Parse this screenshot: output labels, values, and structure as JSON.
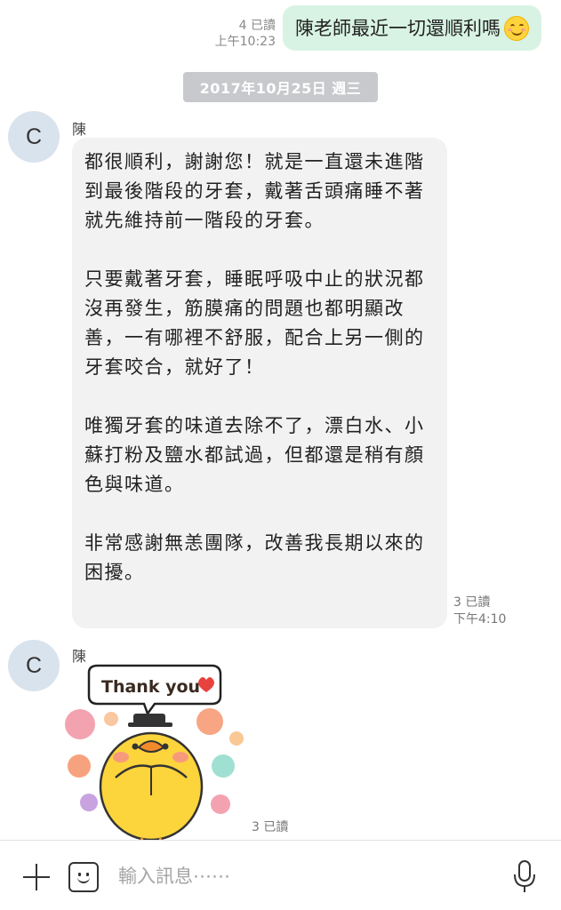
{
  "outgoing": {
    "text": "陳老師最近一切還順利嗎",
    "emoji": "smiling-face",
    "read_status": "4 已讀",
    "time": "上午10:23"
  },
  "date_divider": "2017年10月25日 週三",
  "incoming": [
    {
      "avatar_letter": "C",
      "sender": "陳",
      "paragraphs": [
        "都很順利，謝謝您！就是一直還未進階到最後階段的牙套，戴著舌頭痛睡不著就先維持前一階段的牙套。",
        "只要戴著牙套，睡眠呼吸中止的狀況都沒再發生，筋膜痛的問題也都明顯改善，一有哪裡不舒服，配合上另一側的牙套咬合，就好了！",
        "唯獨牙套的味道去除不了，漂白水、小蘇打粉及鹽水都試過，但都還是稍有顏色與味道。",
        "非常感謝無恙團隊，改善我長期以來的困擾。"
      ],
      "read_status": "3 已讀",
      "time": "下午4:10"
    },
    {
      "avatar_letter": "C",
      "sender": "陳",
      "sticker_text": "Thank you",
      "read_status": "3 已讀"
    }
  ],
  "input": {
    "placeholder": "輸入訊息⋯⋯"
  },
  "colors": {
    "outgoing_bubble": "#d8f3e3",
    "incoming_bubble": "#f2f2f2",
    "date_chip": "#c8c9cc",
    "avatar_bg": "#d9e3ee"
  }
}
